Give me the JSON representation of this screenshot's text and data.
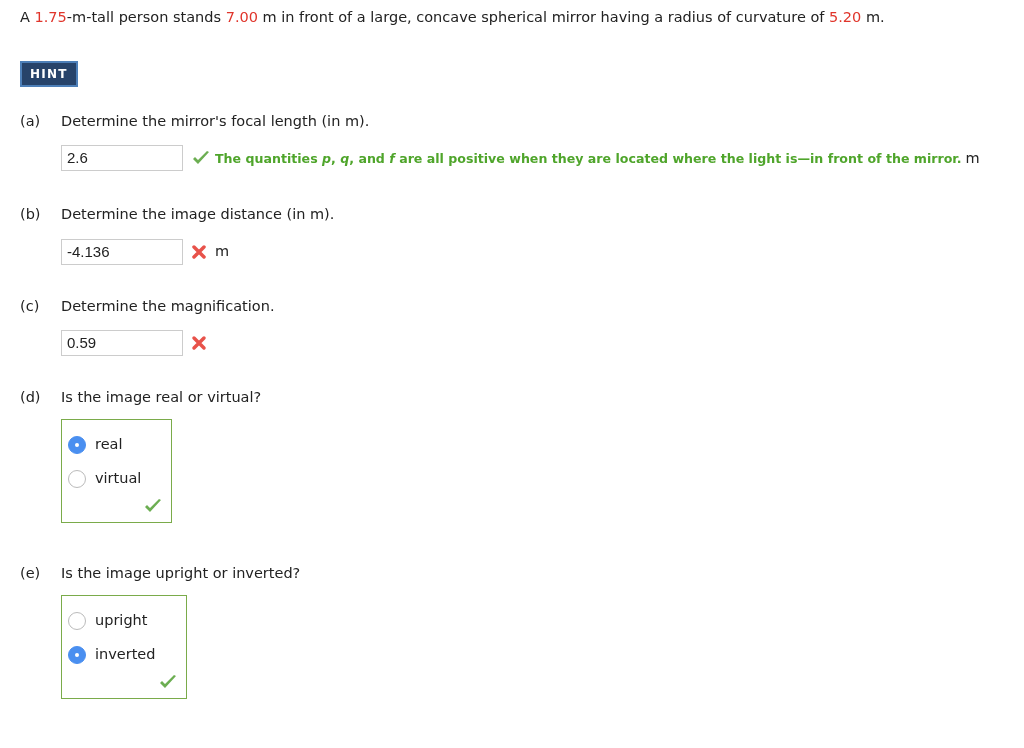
{
  "problem": [
    {
      "kind": "plain",
      "text": "A "
    },
    {
      "kind": "value",
      "text": "1.75"
    },
    {
      "kind": "plain",
      "text": "-m-tall person stands "
    },
    {
      "kind": "value",
      "text": "7.00"
    },
    {
      "kind": "plain",
      "text": " m in front of a large, concave spherical mirror having a radius of curvature of "
    },
    {
      "kind": "value",
      "text": "5.20"
    },
    {
      "kind": "plain",
      "text": " m."
    }
  ],
  "hint_button": "HINT",
  "parts": [
    {
      "kind": "entry",
      "label": "(a)",
      "question": "Determine the mirror's focal length (in m).",
      "value": "2.6",
      "correct": true,
      "feedback": "The quantities *p*, *q*, and *f* are all positive when they are located where the light is—in front of the mirror.",
      "unit": "m"
    },
    {
      "kind": "entry",
      "label": "(b)",
      "question": "Determine the image distance (in m).",
      "value": "-4.136",
      "correct": false,
      "unit": "m"
    },
    {
      "kind": "entry",
      "label": "(c)",
      "question": "Determine the magnification.",
      "value": "0.59",
      "correct": false
    },
    {
      "kind": "choice",
      "label": "(d)",
      "question": "Is the image real or virtual?",
      "correct": true,
      "options": [
        {
          "text": "real",
          "selected": true
        },
        {
          "text": "virtual",
          "selected": false
        }
      ]
    },
    {
      "kind": "choice",
      "label": "(e)",
      "question": "Is the image upright or inverted?",
      "correct": true,
      "options": [
        {
          "text": "upright",
          "selected": false
        },
        {
          "text": "inverted",
          "selected": true
        }
      ]
    }
  ]
}
